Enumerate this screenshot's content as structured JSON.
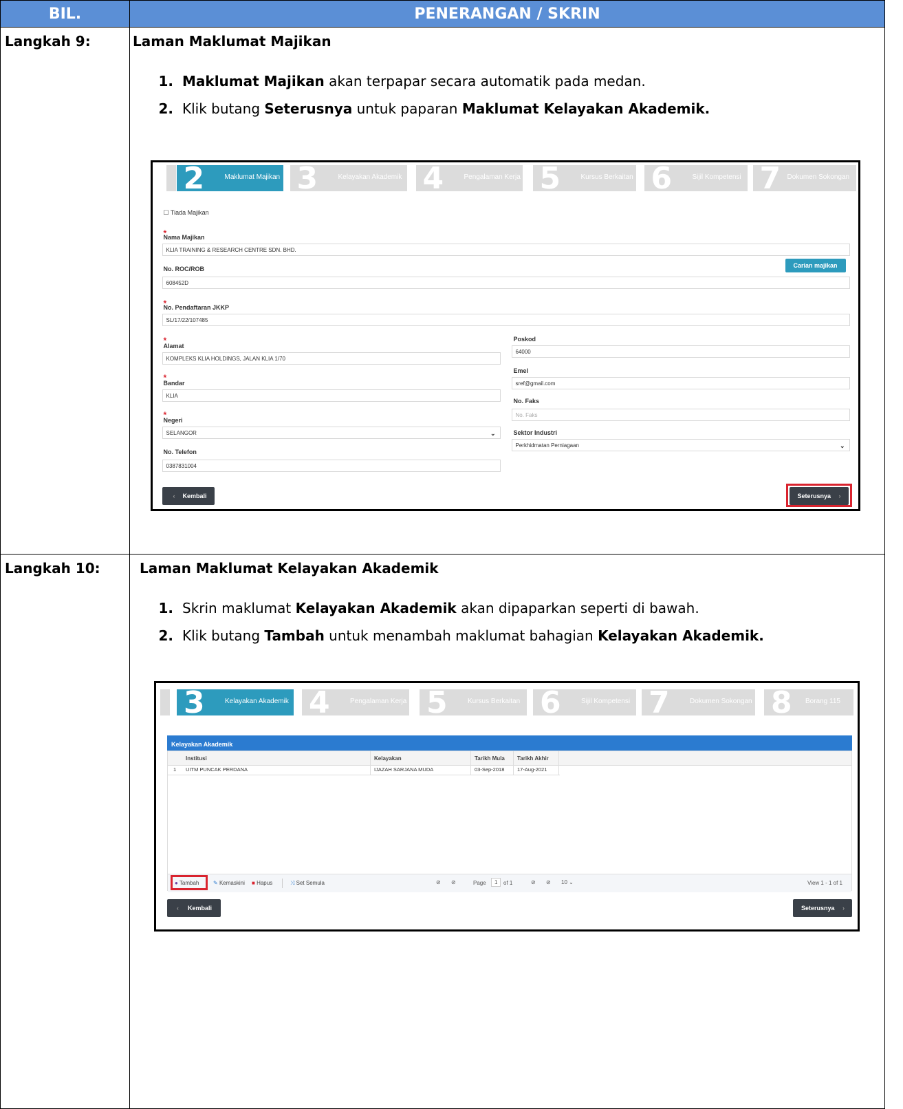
{
  "header": {
    "col1": "BIL.",
    "col2": "PENERANGAN / SKRIN"
  },
  "step9": {
    "label": "Langkah 9:",
    "title": "Laman Maklumat Majikan",
    "item1_bold": "Maklumat Majikan",
    "item1_rest": " akan terpapar secara automatik pada medan.",
    "item2_a": "Klik butang ",
    "item2_b": "Seterusnya",
    "item2_c": " untuk paparan ",
    "item2_d": "Maklumat Kelayakan Akademik."
  },
  "step10": {
    "label": "Langkah 10:",
    "title": "Laman Maklumat Kelayakan Akademik",
    "item1_a": "Skrin maklumat ",
    "item1_b": "Kelayakan Akademik",
    "item1_c": " akan dipaparkan seperti di bawah.",
    "item2_a": "Klik butang ",
    "item2_b": "Tambah",
    "item2_c": " untuk menambah maklumat bahagian ",
    "item2_d": "Kelayakan Akademik."
  },
  "shot1": {
    "steps": [
      {
        "num": "2",
        "label": "Maklumat Majikan"
      },
      {
        "num": "3",
        "label": "Kelayakan Akademik"
      },
      {
        "num": "4",
        "label": "Pengalaman Kerja"
      },
      {
        "num": "5",
        "label": "Kursus Berkaitan"
      },
      {
        "num": "6",
        "label": "Sijil Kompetensi"
      },
      {
        "num": "7",
        "label": "Dokumen Sokongan"
      }
    ],
    "tiada": "Tiada Majikan",
    "nama_label": "Nama Majikan",
    "nama_value": "KLIA TRAINING & RESEARCH CENTRE SDN. BHD.",
    "roc_label": "No. ROC/ROB",
    "carian": "Carian majikan",
    "roc_value": "608452D",
    "jkkp_label": "No. Pendaftaran JKKP",
    "jkkp_value": "SL/17/22/107485",
    "alamat_label": "Alamat",
    "alamat_value": "KOMPLEKS KLIA HOLDINGS, JALAN KLIA 1/70",
    "poskod_label": "Poskod",
    "poskod_value": "64000",
    "emel_label": "Emel",
    "emel_value": "sref@gmail.com",
    "bandar_label": "Bandar",
    "bandar_value": "KLIA",
    "faks_label": "No. Faks",
    "faks_placeholder": "No. Faks",
    "negeri_label": "Negeri",
    "negeri_value": "SELANGOR",
    "sektor_label": "Sektor Industri",
    "sektor_value": "Perkhidmatan Perniagaan",
    "telefon_label": "No. Telefon",
    "telefon_value": "0387831004",
    "kembali": "Kembali",
    "seterusnya": "Seterusnya"
  },
  "shot2": {
    "steps": [
      {
        "num": "3",
        "label": "Kelayakan Akademik"
      },
      {
        "num": "4",
        "label": "Pengalaman Kerja"
      },
      {
        "num": "5",
        "label": "Kursus Berkaitan"
      },
      {
        "num": "6",
        "label": "Sijil Kompetensi"
      },
      {
        "num": "7",
        "label": "Dokumen Sokongan"
      },
      {
        "num": "8",
        "label": "Borang 115"
      }
    ],
    "grid_title": "Kelayakan Akademik",
    "columns": [
      "Institusi",
      "Kelayakan",
      "Tarikh Mula",
      "Tarikh Akhir"
    ],
    "rows": [
      {
        "no": "1",
        "institusi": "UITM PUNCAK PERDANA",
        "kelayakan": "IJAZAH SARJANA MUDA",
        "mula": "03-Sep-2018",
        "akhir": "17-Aug-2021"
      }
    ],
    "tambah": "Tambah",
    "kemaskini": "Kemaskini",
    "hapus": "Hapus",
    "set_semula": "Set Semula",
    "page_label": "Page",
    "page_value": "1",
    "page_of": "of 1",
    "page_size": "10",
    "view": "View 1 - 1 of 1",
    "kembali": "Kembali",
    "seterusnya": "Seterusnya"
  }
}
